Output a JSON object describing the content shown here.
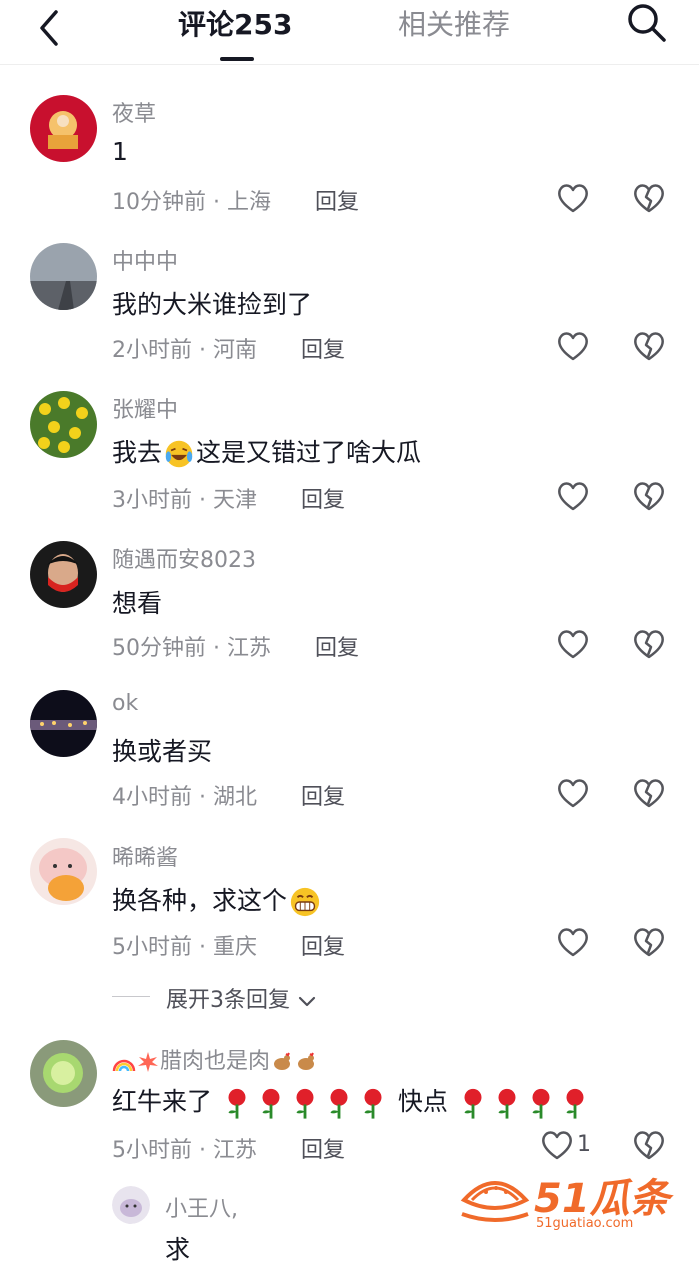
{
  "header": {
    "tab_comments": "评论253",
    "tab_related": "相关推荐"
  },
  "comments": [
    {
      "user": "夜草",
      "text": "1",
      "time": "10分钟前 · 上海",
      "reply": "回复"
    },
    {
      "user": "中中中",
      "text": "我的大米谁捡到了",
      "time": "2小时前 · 河南",
      "reply": "回复"
    },
    {
      "user": "张耀中",
      "text_before": "我去",
      "text_after": "这是又错过了啥大瓜",
      "time": "3小时前 · 天津",
      "reply": "回复"
    },
    {
      "user": "随遇而安8023",
      "text": "想看",
      "time": "50分钟前 · 江苏",
      "reply": "回复"
    },
    {
      "user": "ok",
      "text": "换或者买",
      "time": "4小时前 · 湖北",
      "reply": "回复"
    },
    {
      "user": "晞晞酱",
      "text": "换各种，求这个",
      "time": "5小时前 · 重庆",
      "reply": "回复"
    },
    {
      "user": "腊肉也是肉",
      "text_before": "红牛来了",
      "text_after": "快点",
      "time": "5小时前 · 江苏",
      "reply": "回复",
      "likes": "1"
    },
    {
      "user": "小王八,",
      "text": "求"
    }
  ],
  "expand_replies": "展开3条回复",
  "watermark": {
    "brand": "51瓜条",
    "url": "51guatiao.com"
  },
  "colors": {
    "text": "#161823",
    "secondary": "#8a8b91",
    "reply": "#4f5059"
  }
}
